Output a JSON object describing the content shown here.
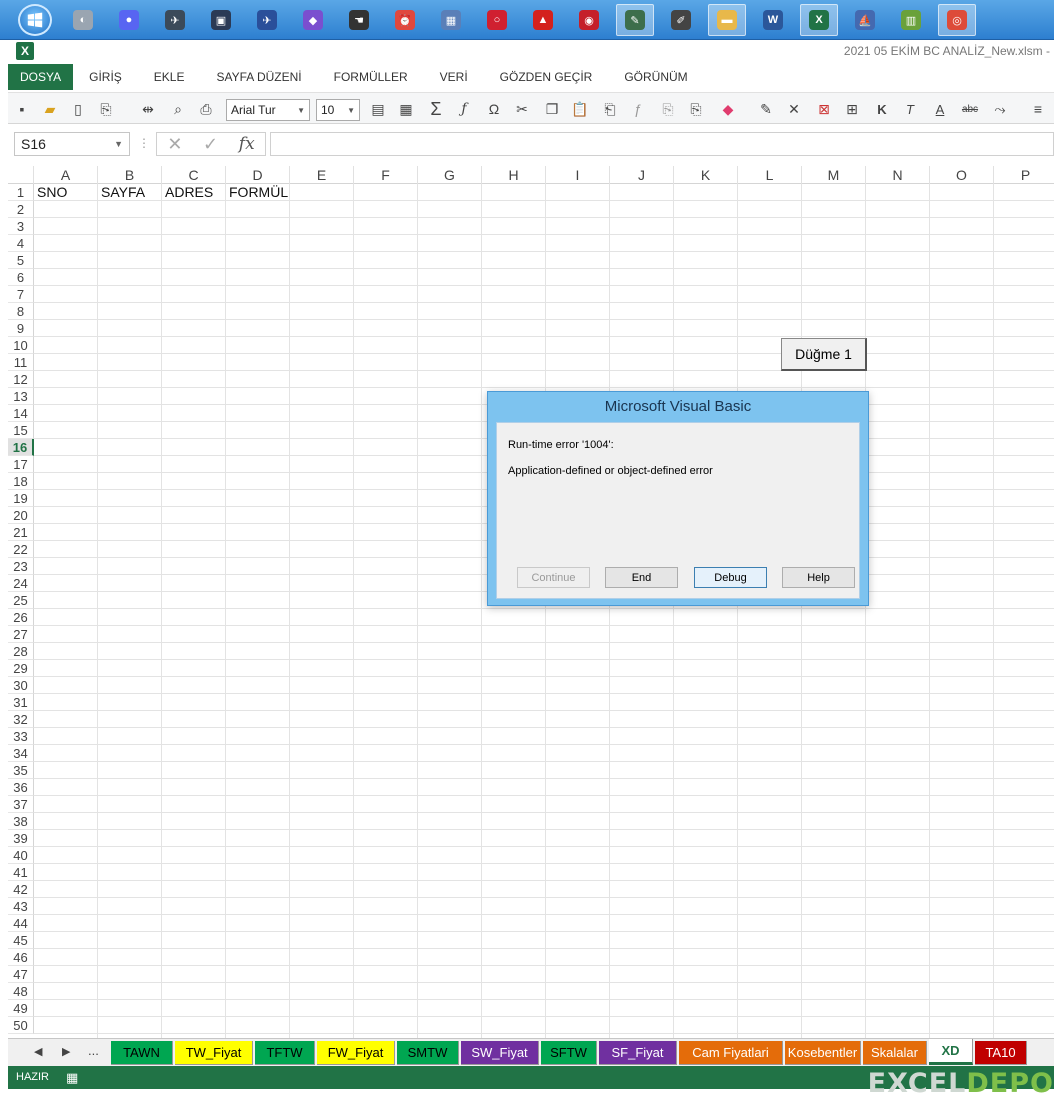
{
  "taskbar": {
    "icons": [
      {
        "name": "browser",
        "color": "#9aa5b1",
        "glyph": "◐"
      },
      {
        "name": "discord",
        "color": "#5865f2",
        "glyph": "●"
      },
      {
        "name": "tool-plane",
        "color": "#3b4a5a",
        "glyph": "✈"
      },
      {
        "name": "app-onb",
        "color": "#2b3a55",
        "glyph": "▣"
      },
      {
        "name": "app-box",
        "color": "#2a4f9a",
        "glyph": "✈"
      },
      {
        "name": "visual-studio",
        "color": "#7a4fcf",
        "glyph": "◆"
      },
      {
        "name": "hand-tool",
        "color": "#333333",
        "glyph": "☚"
      },
      {
        "name": "alarm",
        "color": "#e0483e",
        "glyph": "⏰"
      },
      {
        "name": "calculator",
        "color": "#5a7fb8",
        "glyph": "▦"
      },
      {
        "name": "opera",
        "color": "#d02030",
        "glyph": "○"
      },
      {
        "name": "acrobat",
        "color": "#d4211d",
        "glyph": "▲"
      },
      {
        "name": "app-red",
        "color": "#c51f2a",
        "glyph": "◉"
      },
      {
        "name": "paint",
        "color": "#3d6e4b",
        "glyph": "✎"
      },
      {
        "name": "pen-tool",
        "color": "#444444",
        "glyph": "✐"
      },
      {
        "name": "file-explorer",
        "color": "#e8b84a",
        "glyph": "▬"
      },
      {
        "name": "word",
        "color": "#2b579a",
        "glyph": "W"
      },
      {
        "name": "excel",
        "color": "#217346",
        "glyph": "X"
      },
      {
        "name": "app-ship",
        "color": "#4469b0",
        "glyph": "⛵"
      },
      {
        "name": "app-chart",
        "color": "#6aa13a",
        "glyph": "▥"
      },
      {
        "name": "chrome",
        "color": "#dd4b39",
        "glyph": "◎"
      }
    ]
  },
  "title": {
    "document": "2021 05 EKİM BC ANALİZ_New.xlsm -"
  },
  "ribbon": {
    "tabs": [
      "DOSYA",
      "GİRİŞ",
      "EKLE",
      "SAYFA DÜZENİ",
      "FORMÜLLER",
      "VERİ",
      "GÖZDEN GEÇİR",
      "GÖRÜNÜM"
    ]
  },
  "toolbar": {
    "font_name": "Arial Tur",
    "font_size": "10",
    "bold_label": "K",
    "italic_label": "T",
    "underline_label": "A",
    "strike_label": "abc"
  },
  "formula_bar": {
    "namebox": "S16",
    "fx_label": "fx",
    "formula": ""
  },
  "grid": {
    "columns": [
      "A",
      "B",
      "C",
      "D",
      "E",
      "F",
      "G",
      "H",
      "I",
      "J",
      "K",
      "L",
      "M",
      "N",
      "O",
      "P"
    ],
    "rows": [
      "1",
      "2",
      "3",
      "4",
      "5",
      "6",
      "7",
      "8",
      "9",
      "10",
      "11",
      "12",
      "13",
      "14",
      "15",
      "16",
      "17",
      "18",
      "19",
      "20",
      "21",
      "22",
      "23",
      "24",
      "25",
      "26",
      "27",
      "28",
      "29",
      "30",
      "31",
      "32",
      "33",
      "34",
      "35",
      "36",
      "37",
      "38",
      "39",
      "40",
      "41",
      "42",
      "43",
      "44",
      "45",
      "46",
      "47",
      "48",
      "49",
      "50"
    ],
    "selected_row": "16",
    "header_cells": {
      "A1": "SNO",
      "B1": "SAYFA",
      "C1": "ADRES",
      "D1": "FORMÜL"
    }
  },
  "form_button": {
    "label": "Düğme 1"
  },
  "dialog": {
    "title": "Microsoft Visual Basic",
    "error_line": "Run-time error '1004':",
    "message": "Application-defined or object-defined error",
    "buttons": {
      "continue": "Continue",
      "end": "End",
      "debug": "Debug",
      "help": "Help"
    }
  },
  "sheet_tabs": {
    "ellipsis": "...",
    "tabs": [
      {
        "label": "TAWN",
        "color": "#00a651",
        "text": "#000000"
      },
      {
        "label": "TW_Fiyat",
        "color": "#ffff00",
        "text": "#000000"
      },
      {
        "label": "TFTW",
        "color": "#00a651",
        "text": "#000000"
      },
      {
        "label": "FW_Fiyat",
        "color": "#ffff00",
        "text": "#000000"
      },
      {
        "label": "SMTW",
        "color": "#00a651",
        "text": "#000000"
      },
      {
        "label": "SW_Fiyat",
        "color": "#7030a0",
        "text": "#ffffff"
      },
      {
        "label": "SFTW",
        "color": "#00a651",
        "text": "#000000"
      },
      {
        "label": "SF_Fiyat",
        "color": "#7030a0",
        "text": "#ffffff"
      },
      {
        "label": "Cam Fiyatlari",
        "color": "#e46c0a",
        "text": "#ffffff"
      },
      {
        "label": "Kosebentler",
        "color": "#e46c0a",
        "text": "#ffffff"
      },
      {
        "label": "Skalalar",
        "color": "#e46c0a",
        "text": "#ffffff"
      },
      {
        "label": "XD",
        "color": "#ffffff",
        "text": "#217346"
      },
      {
        "label": "TA10",
        "color": "#c00000",
        "text": "#ffffff"
      }
    ],
    "active": "XD"
  },
  "statusbar": {
    "status": "HAZIR"
  },
  "watermark": {
    "part1": "EXCEL",
    "part2": "DEPO"
  },
  "colors": {
    "excel_green": "#217346",
    "dialog_frame": "#7dc3ef"
  }
}
